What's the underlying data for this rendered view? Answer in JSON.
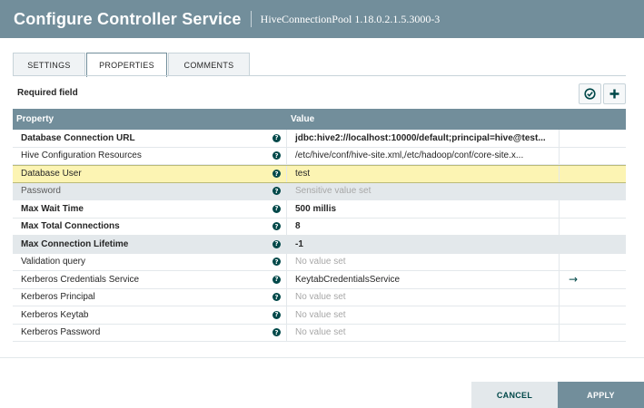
{
  "dialog": {
    "title": "Configure Controller Service",
    "subtitle": "HiveConnectionPool 1.18.0.2.1.5.3000-3"
  },
  "tabs": [
    {
      "label": "SETTINGS"
    },
    {
      "label": "PROPERTIES"
    },
    {
      "label": "COMMENTS"
    }
  ],
  "required_label": "Required field",
  "table": {
    "headers": [
      "Property",
      "Value"
    ],
    "rows": [
      {
        "name": "Database Connection URL",
        "value": "jdbc:hive2://localhost:10000/default;principal=hive@test...",
        "required": true
      },
      {
        "name": "Hive Configuration Resources",
        "value": "/etc/hive/conf/hive-site.xml,/etc/hadoop/conf/core-site.x...",
        "required": false
      },
      {
        "name": "Database User",
        "value": "test",
        "required": false,
        "selected": true
      },
      {
        "name": "Password",
        "value": "Sensitive value set",
        "required": false,
        "unset": true
      },
      {
        "name": "Max Wait Time",
        "value": "500 millis",
        "required": true
      },
      {
        "name": "Max Total Connections",
        "value": "8",
        "required": true
      },
      {
        "name": "Max Connection Lifetime",
        "value": "-1",
        "required": true
      },
      {
        "name": "Validation query",
        "value": "No value set",
        "required": false,
        "unset": true
      },
      {
        "name": "Kerberos Credentials Service",
        "value": "KeytabCredentialsService",
        "required": false,
        "arrow": "→"
      },
      {
        "name": "Kerberos Principal",
        "value": "No value set",
        "required": false,
        "unset": true
      },
      {
        "name": "Kerberos Keytab",
        "value": "No value set",
        "required": false,
        "unset": true
      },
      {
        "name": "Kerberos Password",
        "value": "No value set",
        "required": false,
        "unset": true
      }
    ]
  },
  "footer": {
    "cancel_label": "CANCEL",
    "apply_label": "APPLY"
  },
  "icons": {
    "verify": "check-circle-icon",
    "add": "plus-icon",
    "help": "question-circle-icon",
    "goto": "arrow-right-icon"
  },
  "colors": {
    "header": "#728e9b",
    "selected_row": "#fcf4b3",
    "accent": "#004849"
  }
}
